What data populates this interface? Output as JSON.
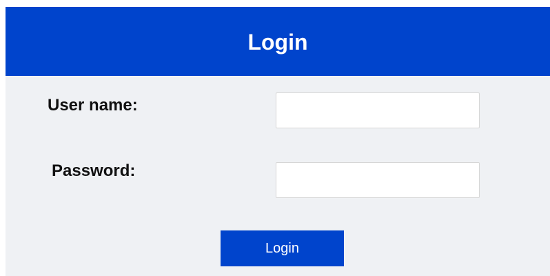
{
  "header": {
    "title": "Login"
  },
  "form": {
    "username_label": "User name:",
    "username_value": "",
    "password_label": "Password:",
    "password_value": "",
    "submit_label": "Login"
  },
  "colors": {
    "brand_blue": "#0044cc",
    "panel_background": "#eff1f4"
  }
}
